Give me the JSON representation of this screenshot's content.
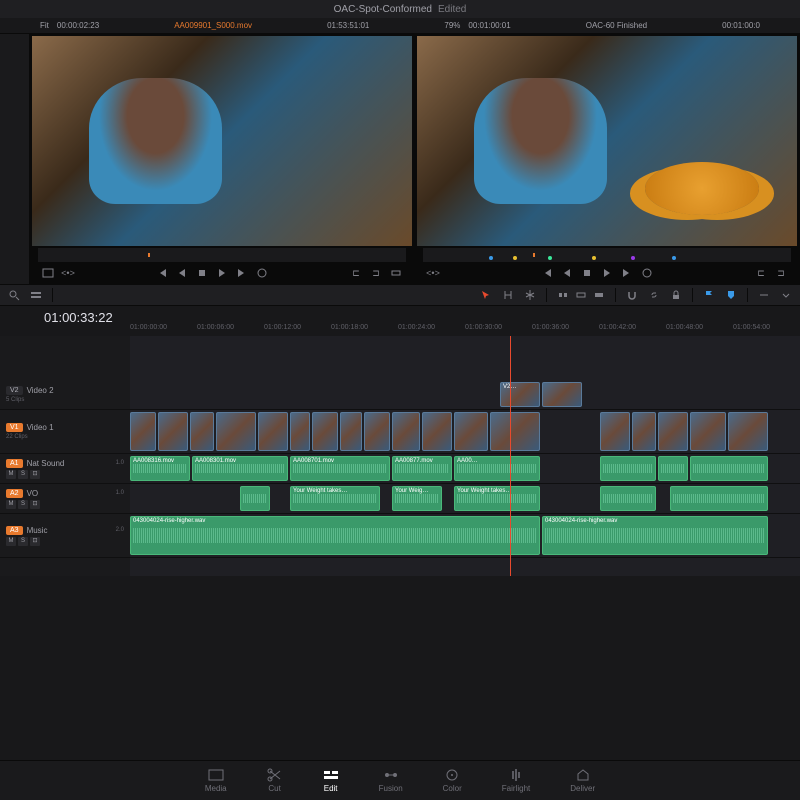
{
  "title": {
    "project": "OAC-Spot-Conformed",
    "status": "Edited"
  },
  "source": {
    "fit": "Fit",
    "tc": "00:00:02:23",
    "clip": "AA009901_S000.mov",
    "dur": "01:53:51:01"
  },
  "program": {
    "zoom": "79%",
    "tc": "00:01:00:01",
    "seq": "OAC-60 Finished",
    "dur": "00:01:00:0"
  },
  "timeline": {
    "playhead": "01:00:33:22",
    "ruler": [
      "01:00:00:00",
      "01:00:06:00",
      "01:00:12:00",
      "01:00:18:00",
      "01:00:24:00",
      "01:00:30:00",
      "01:00:36:00",
      "01:00:42:00",
      "01:00:48:00",
      "01:00:54:00"
    ]
  },
  "tracks": [
    {
      "id": "V2",
      "name": "Video 2",
      "sub": "5 Clips",
      "type": "v",
      "on": false
    },
    {
      "id": "V1",
      "name": "Video 1",
      "sub": "22 Clips",
      "type": "v",
      "on": true
    },
    {
      "id": "A1",
      "name": "Nat Sound",
      "sub": "",
      "type": "a",
      "on": true,
      "level": "1.0"
    },
    {
      "id": "A2",
      "name": "VO",
      "sub": "",
      "type": "a",
      "on": true,
      "level": "1.0"
    },
    {
      "id": "A3",
      "name": "Music",
      "sub": "",
      "type": "a",
      "on": true,
      "level": "2.0"
    }
  ],
  "clipLabels": {
    "v2a": "V2…",
    "a1": "AA008316.mov",
    "a2": "AA008301.mov",
    "a3": "AA008701.mov",
    "a4": "AA00877.mov",
    "a5": "AA00…",
    "vo1": "Your Weight takes…",
    "vo2": "Your Weig…",
    "vo3": "Your Weight takes…",
    "m1": "043004024-rise-higher.wav",
    "m2": "043004024-rise-higher.wav"
  },
  "nav": [
    {
      "k": "media",
      "l": "Media"
    },
    {
      "k": "cut",
      "l": "Cut"
    },
    {
      "k": "edit",
      "l": "Edit"
    },
    {
      "k": "fusion",
      "l": "Fusion"
    },
    {
      "k": "color",
      "l": "Color"
    },
    {
      "k": "fairlight",
      "l": "Fairlight"
    },
    {
      "k": "deliver",
      "l": "Deliver"
    }
  ],
  "activeNav": "edit"
}
